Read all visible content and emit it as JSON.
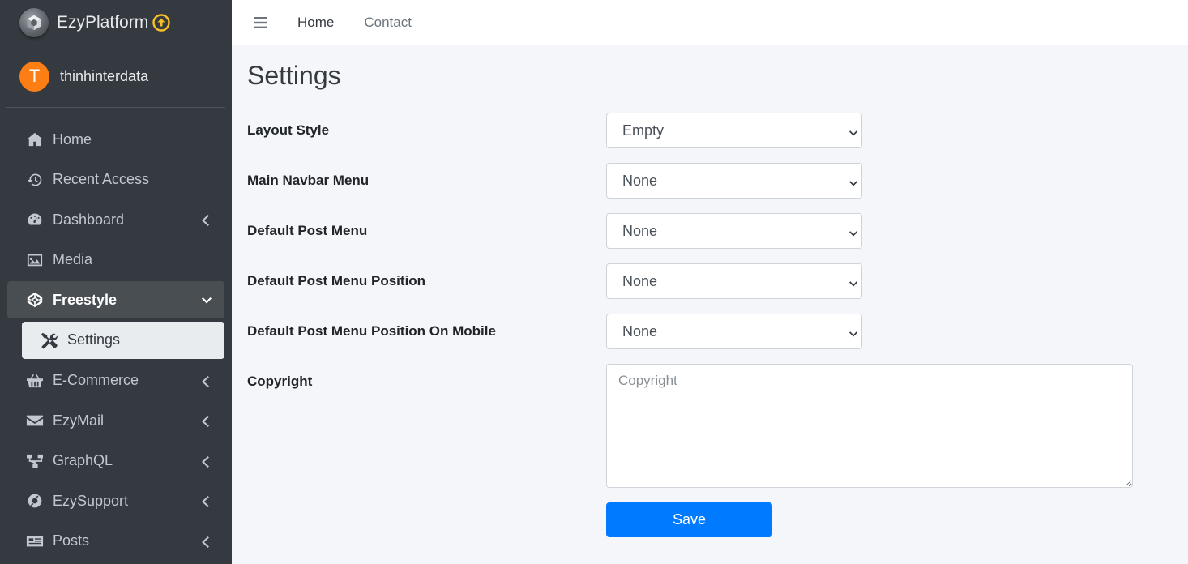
{
  "brand": {
    "name": "EzyPlatform",
    "logo_icon": "cube-icon",
    "badge_icon": "arrow-up-circle-icon",
    "badge_color": "#f6c026"
  },
  "user": {
    "initial": "T",
    "name": "thinhinterdata",
    "avatar_color": "#fd7e14"
  },
  "sidebar": {
    "items": [
      {
        "label": "Home",
        "icon": "home-icon"
      },
      {
        "label": "Recent Access",
        "icon": "history-icon"
      },
      {
        "label": "Dashboard",
        "icon": "tachometer-icon",
        "expandable": true
      },
      {
        "label": "Media",
        "icon": "image-icon"
      },
      {
        "label": "Freestyle",
        "icon": "codepen-icon",
        "expandable": true,
        "open": true
      },
      {
        "label": "Settings",
        "icon": "tools-icon",
        "active": true,
        "sub": true
      },
      {
        "label": "E-Commerce",
        "icon": "basket-icon",
        "expandable": true
      },
      {
        "label": "EzyMail",
        "icon": "envelope-icon",
        "expandable": true
      },
      {
        "label": "GraphQL",
        "icon": "project-diagram-icon",
        "expandable": true
      },
      {
        "label": "EzySupport",
        "icon": "life-ring-icon",
        "expandable": true
      },
      {
        "label": "Posts",
        "icon": "newspaper-icon",
        "expandable": true
      }
    ]
  },
  "topnav": {
    "home": "Home",
    "contact": "Contact"
  },
  "page": {
    "title": "Settings"
  },
  "form": {
    "layout_style": {
      "label": "Layout Style",
      "value": "Empty"
    },
    "main_navbar_menu": {
      "label": "Main Navbar Menu",
      "value": "None"
    },
    "default_post_menu": {
      "label": "Default Post Menu",
      "value": "None"
    },
    "default_post_menu_position": {
      "label": "Default Post Menu Position",
      "value": "None"
    },
    "default_post_menu_position_mobile": {
      "label": "Default Post Menu Position On Mobile",
      "value": "None"
    },
    "copyright": {
      "label": "Copyright",
      "placeholder": "Copyright",
      "value": ""
    },
    "save_label": "Save"
  },
  "colors": {
    "sidebar_bg": "#343a40",
    "content_bg": "#f4f6f9",
    "primary": "#007bff"
  }
}
